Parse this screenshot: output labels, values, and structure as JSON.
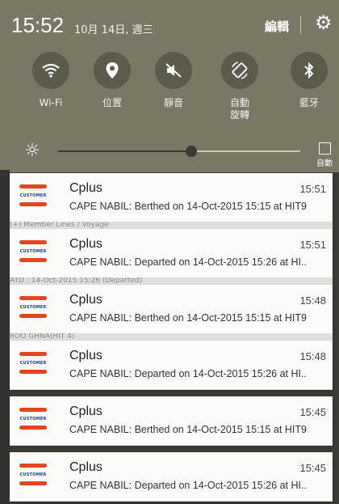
{
  "status": {
    "time": "15:52",
    "date": "10月 14日, 週三",
    "edit_label": "編輯",
    "gear_icon": "gear-icon"
  },
  "toggles": [
    {
      "name": "wifi",
      "icon": "wifi-icon",
      "glyph": "≋",
      "label": "Wi-Fi"
    },
    {
      "name": "location",
      "icon": "location-icon",
      "glyph": "⚲",
      "label": "位置"
    },
    {
      "name": "mute",
      "icon": "mute-icon",
      "glyph": "✕",
      "label": "靜音"
    },
    {
      "name": "auto-rotate",
      "icon": "rotate-icon",
      "glyph": "⟳",
      "label": "自動\n旋轉"
    },
    {
      "name": "bluetooth",
      "icon": "bluetooth-icon",
      "glyph": "ᛒ",
      "label": "藍牙"
    }
  ],
  "brightness": {
    "level": 0.55,
    "auto_label": "自動"
  },
  "notifications": [
    {
      "app": "Cplus",
      "time": "15:51",
      "body": "CAPE NABIL: Berthed on 14-Oct-2015 15:15 at HIT9",
      "icon_text": "CUSTOMER"
    },
    {
      "app": "Cplus",
      "time": "15:51",
      "body": "CAPE NABIL: Departed on 14-Oct-2015 15:26 at HI..",
      "icon_text": "CUSTOMER"
    },
    {
      "app": "Cplus",
      "time": "15:48",
      "body": "CAPE NABIL: Berthed on 14-Oct-2015 15:15 at HIT9",
      "icon_text": "CUSTOMER"
    },
    {
      "app": "Cplus",
      "time": "15:48",
      "body": "CAPE NABIL: Departed on 14-Oct-2015 15:26 at HI..",
      "icon_text": "CUSTOMER"
    },
    {
      "app": "Cplus",
      "time": "15:45",
      "body": "CAPE NABIL: Berthed on 14-Oct-2015 15:15 at HIT9",
      "icon_text": "CUSTOMER"
    },
    {
      "app": "Cplus",
      "time": "15:45",
      "body": "CAPE NABIL: Departed on 14-Oct-2015 15:26 at HI..",
      "icon_text": "CUSTOMER"
    }
  ],
  "background_snippets": [
    "(+) Member Lines / Voyage",
    "ATD : 14-Oct-2015 15:26 (Departed)",
    "ROO GHNA(HIT 4)"
  ]
}
